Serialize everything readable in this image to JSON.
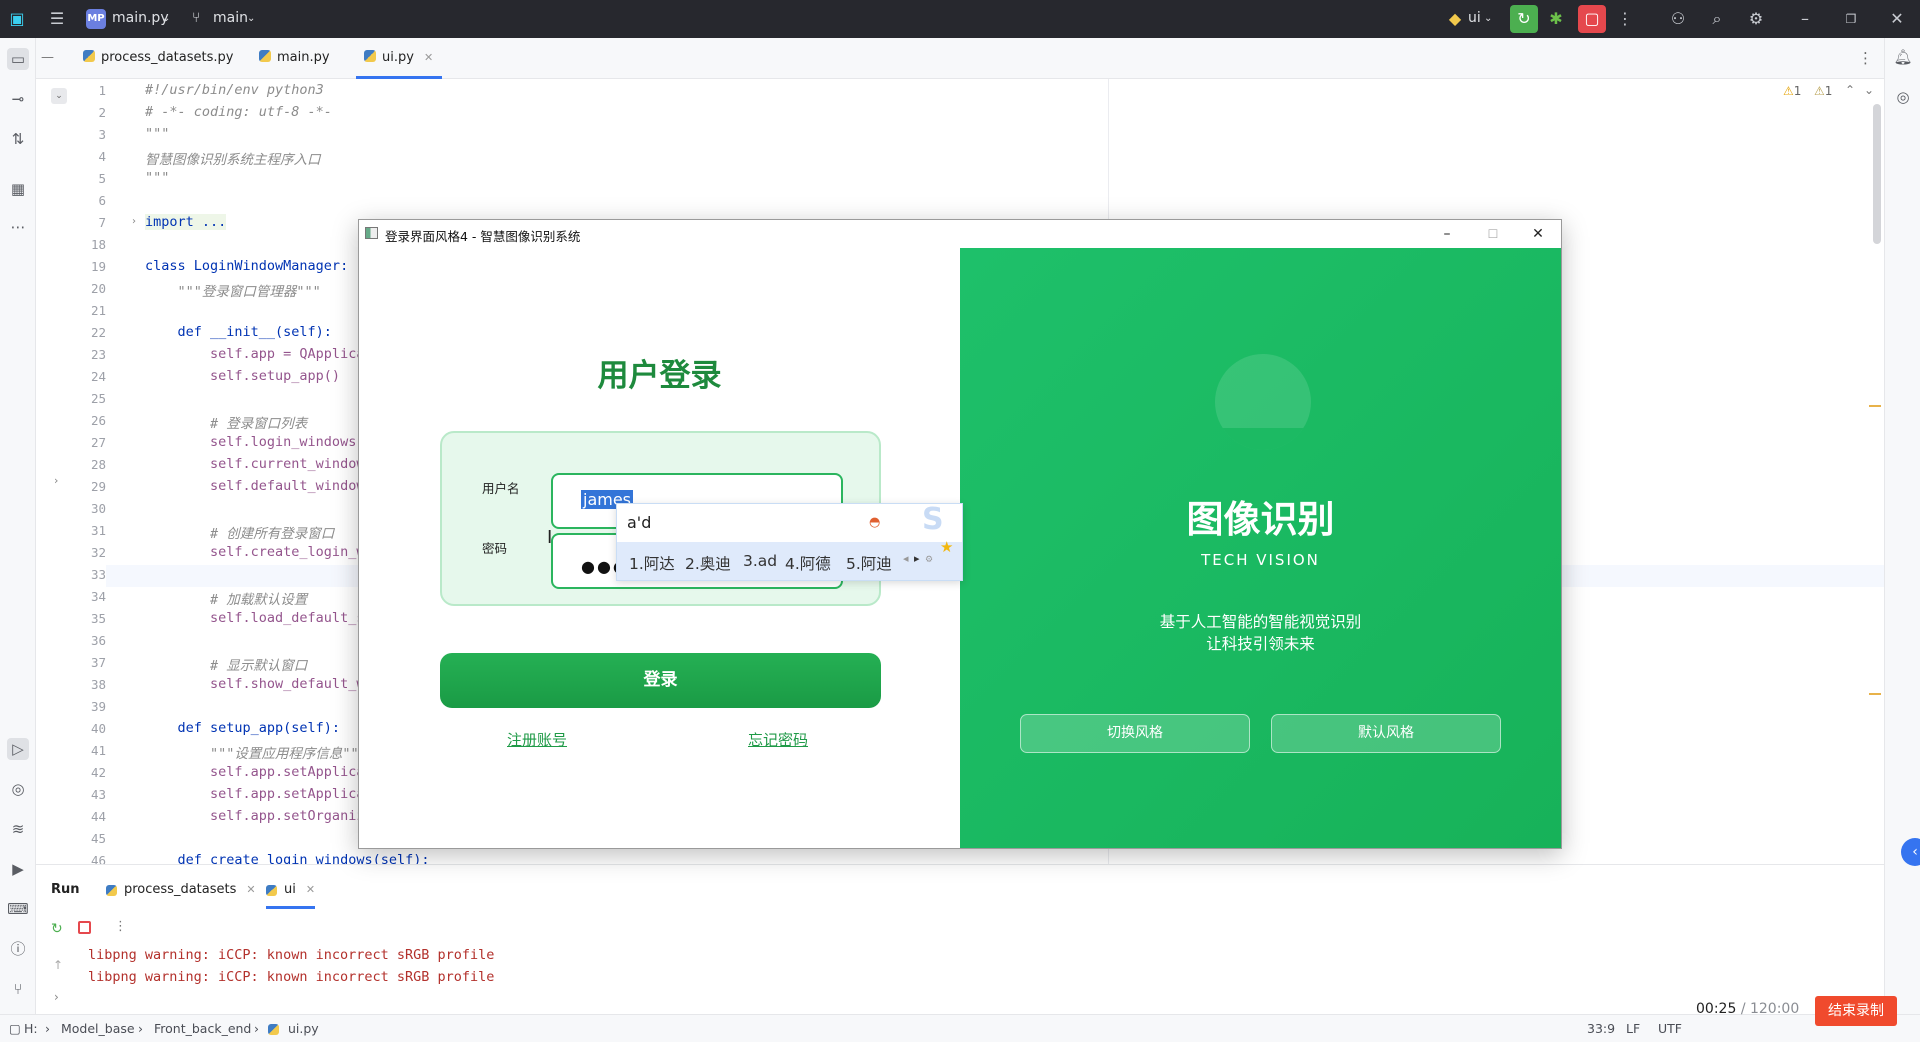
{
  "titlebar": {
    "project_badge": "MP",
    "project_name": "main.py",
    "branch": "main",
    "run_config": "ui"
  },
  "tabs": [
    {
      "label": "process_datasets.py"
    },
    {
      "label": "main.py"
    },
    {
      "label": "ui.py"
    }
  ],
  "editor": {
    "line_numbers": [
      "1",
      "2",
      "3",
      "4",
      "5",
      "6",
      "7",
      "18",
      "19",
      "20",
      "21",
      "22",
      "23",
      "24",
      "25",
      "26",
      "27",
      "28",
      "29",
      "30",
      "31",
      "32",
      "33",
      "34",
      "35",
      "36",
      "37",
      "38",
      "39",
      "40",
      "41",
      "42",
      "43",
      "44",
      "45",
      "46"
    ],
    "lines": [
      "#!/usr/bin/env python3",
      "# -*- coding: utf-8 -*-",
      "\"\"\"",
      "智慧图像识别系统主程序入口",
      "\"\"\"",
      "",
      "import ...",
      "",
      "class LoginWindowManager:",
      "    \"\"\"登录窗口管理器\"\"\"",
      "",
      "    def __init__(self):",
      "        self.app = QApplica",
      "        self.setup_app()",
      "",
      "        # 登录窗口列表",
      "        self.login_windows",
      "        self.current_window",
      "        self.default_window",
      "",
      "        # 创建所有登录窗口",
      "        self.create_login_w",
      "",
      "        # 加载默认设置",
      "        self.load_default_s",
      "",
      "        # 显示默认窗口",
      "        self.show_default_w",
      "",
      "    def setup_app(self):",
      "        \"\"\"设置应用程序信息\"\"\"",
      "        self.app.setApplica",
      "        self.app.setApplica",
      "        self.app.setOrganiz",
      "",
      "    def create_login_windows(self):"
    ],
    "inspections": {
      "warnings": "1",
      "weak_warnings": "1"
    }
  },
  "run_panel": {
    "title": "Run",
    "tabs": [
      {
        "label": "process_datasets"
      },
      {
        "label": "ui"
      }
    ],
    "output": [
      "libpng warning: iCCP: known incorrect sRGB profile",
      "libpng warning: iCCP: known incorrect sRGB profile"
    ]
  },
  "statusbar": {
    "breadcrumb": [
      "H:",
      "Model_base",
      "Front_back_end",
      "ui.py"
    ],
    "position": "33:9",
    "line_sep": "LF",
    "encoding": "UTF"
  },
  "recording": {
    "elapsed": "00:25",
    "total": "/ 120:00",
    "stop_label": "结束录制"
  },
  "login_window": {
    "title": "登录界面风格4 - 智慧图像识别系统",
    "heading": "用户登录",
    "username_label": "用户名",
    "username_value": "james",
    "password_label": "密码",
    "password_mask": "●●●●",
    "login_button": "登录",
    "register_link": "注册账号",
    "forgot_link": "忘记密码",
    "brand_title": "图像识别",
    "brand_subtitle": "TECH VISION",
    "tagline_1": "基于人工智能的智能视觉识别",
    "tagline_2": "让科技引领未来",
    "switch_style_button": "切换风格",
    "default_style_button": "默认风格",
    "accent_color": "#1ec06a"
  },
  "ime": {
    "composition": "a'd",
    "candidates": [
      "1.阿达",
      "2.奥迪",
      "3.ad",
      "4.阿德",
      "5.阿迪"
    ]
  }
}
